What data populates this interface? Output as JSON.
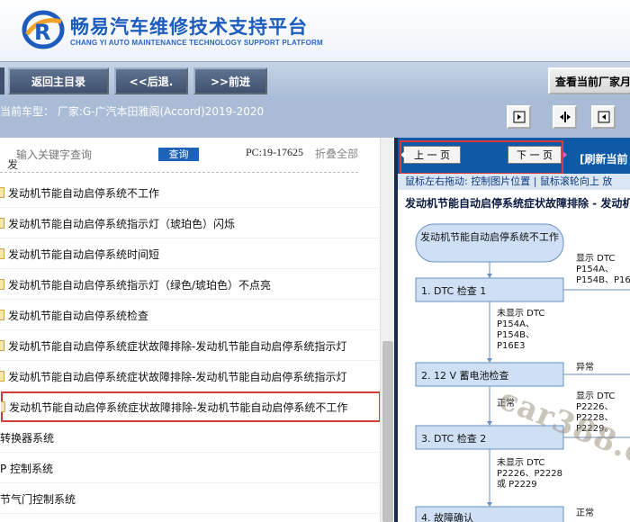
{
  "header": {
    "title": "畅易汽车维修技术支持平台",
    "subtitle": "CHANG YI AUTO MAINTENANCE TECHNOLOGY SUPPORT PLATFORM"
  },
  "nav": {
    "home": "返回主目录",
    "back": "<<后退.",
    "forward": ">>前进",
    "view_manufacturer": "查看当前厂家月"
  },
  "info": {
    "current_model": "当前车型：  厂家:G-广汽本田雅阁(Accord)2019-2020"
  },
  "left": {
    "search_placeholder": "输入关键字查询",
    "search_button": "查询",
    "pc_code": "PC:19-17625",
    "collapse_all": "折叠全部",
    "tree_prefix": "发",
    "items": [
      {
        "label": "发动机节能自动启停系统不工作",
        "type": "doc"
      },
      {
        "label": "发动机节能自动启停系统指示灯（琥珀色）闪烁",
        "type": "doc"
      },
      {
        "label": "发动机节能自动启停系统时间短",
        "type": "doc"
      },
      {
        "label": "发动机节能自动启停系统指示灯（绿色/琥珀色）不点亮",
        "type": "doc"
      },
      {
        "label": "发动机节能自动启停系统检查",
        "type": "doc"
      },
      {
        "label": "发动机节能自动启停系统症状故障排除-发动机节能自动启停系统指示灯",
        "type": "doc"
      },
      {
        "label": "发动机节能自动启停系统症状故障排除-发动机节能自动启停系统指示灯",
        "type": "doc"
      },
      {
        "label": "发动机节能自动启停系统症状故障排除-发动机节能自动启停系统不工作",
        "type": "doc",
        "selected": true
      },
      {
        "label": "转换器系统",
        "type": "folder"
      },
      {
        "label": "P 控制系统",
        "type": "folder"
      },
      {
        "label": "节气门控制系统",
        "type": "folder"
      }
    ]
  },
  "right": {
    "prev_page": "上 一 页",
    "next_page": "下 一 页",
    "refresh": "[刷新当前",
    "hint": "鼠标左右拖动: 控制图片位置 | 鼠标滚轮向上 放",
    "doc_title": "发动机节能自动启停系统症状故障排除 - 发动机节",
    "flow": {
      "start": "发动机节能自动启停系统不工作",
      "step1": "1.  DTC 检查 1",
      "step1_side": "显示 DTC",
      "step1_side_codes": "P154A、",
      "step1_side_codes2": "P154B、P16",
      "step1_down": "未显示 DTC",
      "step1_down_codes": [
        "P154A、",
        "P154B、",
        "P16E3"
      ],
      "step2": "2.  12 V 蓄电池检查",
      "step2_side": "异常",
      "step2_down": "正常",
      "step2_down_side": "显示 DTC",
      "step2_down_side_codes": [
        "P2226、",
        "P2228、",
        "P2229。"
      ],
      "step3": "3.  DTC 检查 2",
      "step3_down": "未显示 DTC",
      "step3_down_codes": [
        "P2226、P2228",
        "或 P2229"
      ],
      "step4": "4.  故障确认",
      "step4_side": "正常"
    },
    "watermark": "car388.c"
  }
}
